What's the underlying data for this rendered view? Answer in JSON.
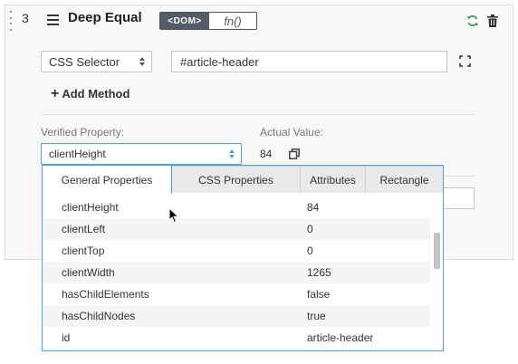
{
  "step": {
    "number": "3",
    "title": "Deep Equal",
    "toggle": {
      "active_label": "<DOM>",
      "inactive_label": "fn()"
    }
  },
  "selector": {
    "type_value": "CSS Selector",
    "value": "#article-header"
  },
  "add_method_label": "Add Method",
  "verified_property": {
    "label": "Verified Property:",
    "value": "clientHeight"
  },
  "actual_value": {
    "label": "Actual Value:",
    "value": "84"
  },
  "dropdown": {
    "tabs": [
      {
        "label": "General Properties",
        "active": true
      },
      {
        "label": "CSS Properties",
        "active": false
      },
      {
        "label": "Attributes",
        "active": false
      },
      {
        "label": "Rectangle",
        "active": false
      }
    ],
    "rows": [
      {
        "name": "clientHeight",
        "value": "84"
      },
      {
        "name": "clientLeft",
        "value": "0"
      },
      {
        "name": "clientTop",
        "value": "0"
      },
      {
        "name": "clientWidth",
        "value": "1265"
      },
      {
        "name": "hasChildElements",
        "value": "false"
      },
      {
        "name": "hasChildNodes",
        "value": "true"
      },
      {
        "name": "id",
        "value": "article-header"
      }
    ]
  },
  "colors": {
    "accent": "#4aa3df",
    "toggle_active": "#555c69",
    "icon_green": "#3d9b6d"
  },
  "icons": [
    "drag-handle-icon",
    "reorder-icon",
    "refresh-icon",
    "trash-icon",
    "expand-icon",
    "plus-icon",
    "copy-icon",
    "mouse-cursor-icon"
  ]
}
